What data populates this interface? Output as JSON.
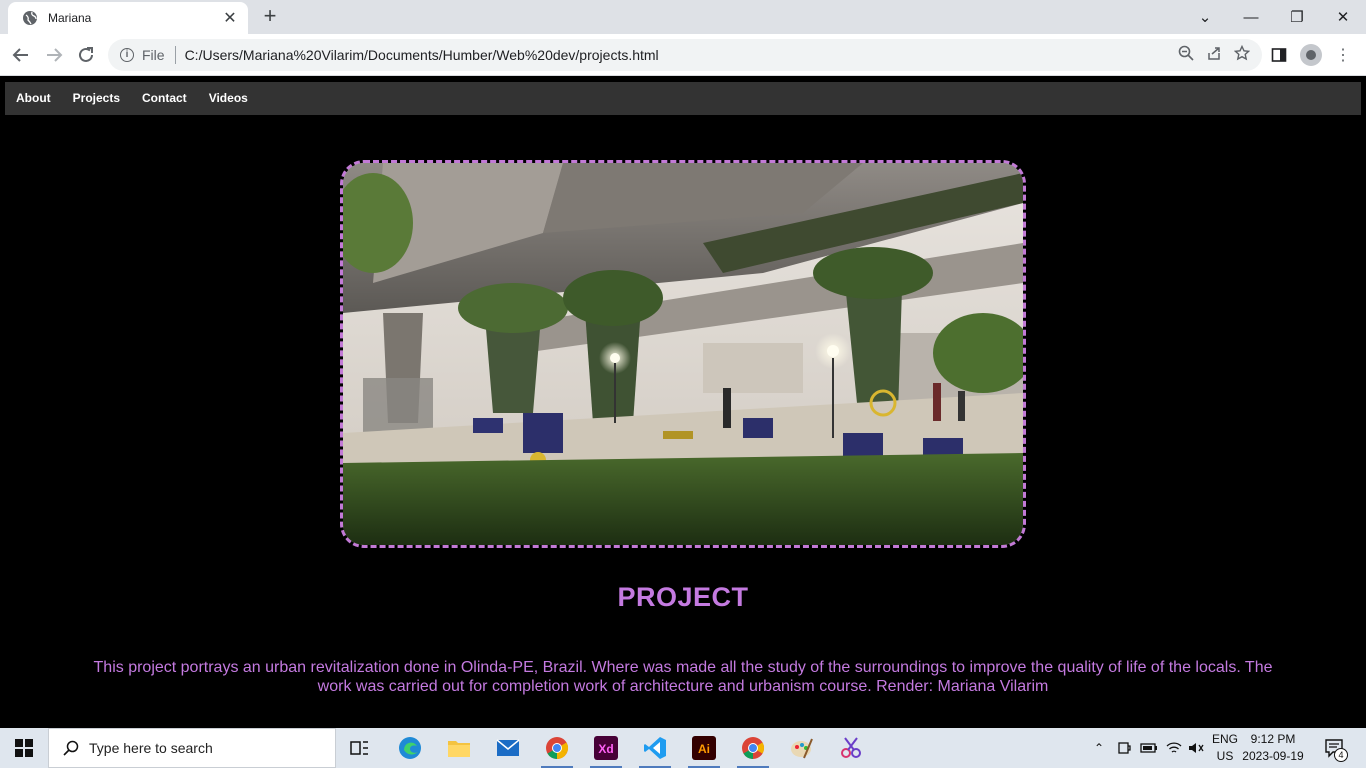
{
  "browser": {
    "tab_title": "Mariana",
    "file_label": "File",
    "url": "C:/Users/Mariana%20Vilarim/Documents/Humber/Web%20dev/projects.html"
  },
  "site": {
    "nav": [
      "About",
      "Projects",
      "Contact",
      "Videos"
    ],
    "project_title": "PROJECT",
    "project_description": "This project portrays an urban revitalization done in Olinda-PE, Brazil. Where was made all the study of the surroundings to improve the quality of life of the locals. The work was carried out for completion work of architecture and urbanism course. Render: Mariana Vilarim",
    "accent_color": "#c47ae0",
    "nav_bg": "#333333"
  },
  "taskbar": {
    "search_placeholder": "Type here to search",
    "lang_top": "ENG",
    "lang_bottom": "US",
    "time": "9:12 PM",
    "date": "2023-09-19",
    "notification_count": "4"
  }
}
